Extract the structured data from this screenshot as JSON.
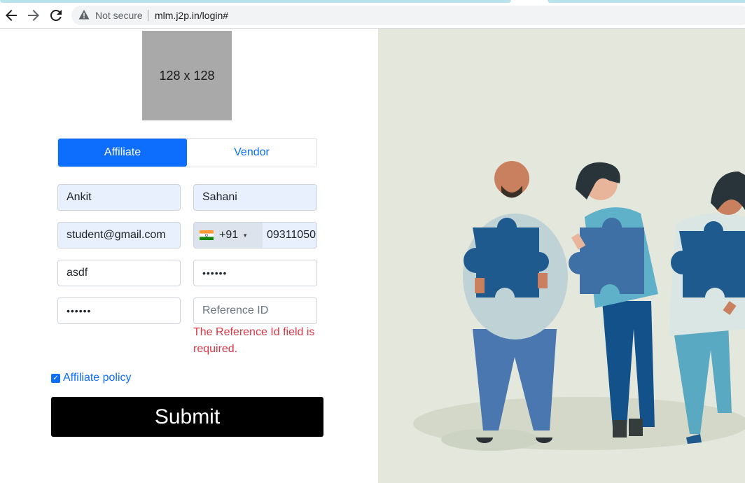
{
  "browser": {
    "security_label": "Not secure",
    "url": "mlm.j2p.in/login#"
  },
  "logo": {
    "placeholder_text": "128 x 128"
  },
  "tabs": [
    {
      "label": "Affiliate",
      "active": true
    },
    {
      "label": "Vendor",
      "active": false
    }
  ],
  "form": {
    "first_name": "Ankit",
    "last_name": "Sahani",
    "email": "student@gmail.com",
    "phone_country_code": "+91",
    "phone_number": "09311050",
    "username": "asdf",
    "password": "••••••",
    "confirm_password": "••••••",
    "reference_id_placeholder": "Reference ID",
    "reference_id_error": "The Reference Id field is required.",
    "policy_label": "Affiliate policy",
    "policy_checked": true,
    "submit_label": "Submit"
  },
  "colors": {
    "primary": "#0d6efd",
    "error": "#dc3545",
    "autofill": "#e8f0fe",
    "illustration_bg": "#e4e7dc"
  }
}
